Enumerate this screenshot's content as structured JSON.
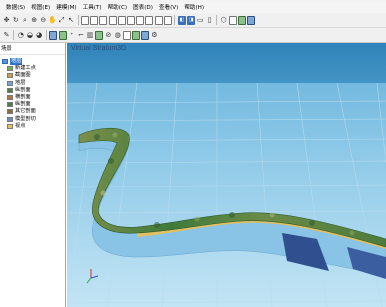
{
  "window": {
    "title": ""
  },
  "menu": {
    "items": [
      "数据(S)",
      "视图(E)",
      "建模(M)",
      "工具(T)",
      "帮助(C)",
      "图表(D)",
      "查看(V)",
      "帮助(H)"
    ]
  },
  "toolbar1": {
    "icons": [
      "move-icon",
      "rotate-icon",
      "zoom-box-icon",
      "zoom-in-icon",
      "zoom-out-icon",
      "pan-icon",
      "zoom-extents-icon",
      "select-icon",
      "box-icon",
      "box-icon",
      "box-icon",
      "box-icon",
      "box-icon",
      "box-icon",
      "box-icon",
      "box-icon",
      "box-icon",
      "box-icon",
      "view-3d-icon",
      "view-top-icon",
      "view-front-icon",
      "view-side-icon",
      "layers-icon",
      "cube-icon",
      "cube-green-icon",
      "cube-blue-icon"
    ]
  },
  "toolbar2": {
    "icons": [
      "wand-icon",
      "paint-icon",
      "surface-icon",
      "volume-icon",
      "drill-icon",
      "section-icon",
      "tunnel-icon",
      "fault-icon",
      "map-icon",
      "terrain-icon",
      "cut-icon",
      "contour-icon",
      "grid-icon",
      "export-icon",
      "import-icon",
      "settings-icon"
    ]
  },
  "panel": {
    "header": "场景",
    "root": "地层",
    "items": [
      "新建工点",
      "截面图",
      "地层",
      "纵剖面",
      "横剖面",
      "纵剖面",
      "其它剖面",
      "模型剖切",
      "视点"
    ]
  },
  "viewport": {
    "title": "Virtual Stratum3D",
    "colors": {
      "sky_top": "#2f83b8",
      "sky_bottom": "#9fd3ec",
      "grid_line": "#b9dcef",
      "terrain_green": "#3f7a3a",
      "stratum_blue": "#89c3e6",
      "stratum_dark": "#2f4f8f",
      "stratum_yellow": "#e0c060"
    }
  }
}
